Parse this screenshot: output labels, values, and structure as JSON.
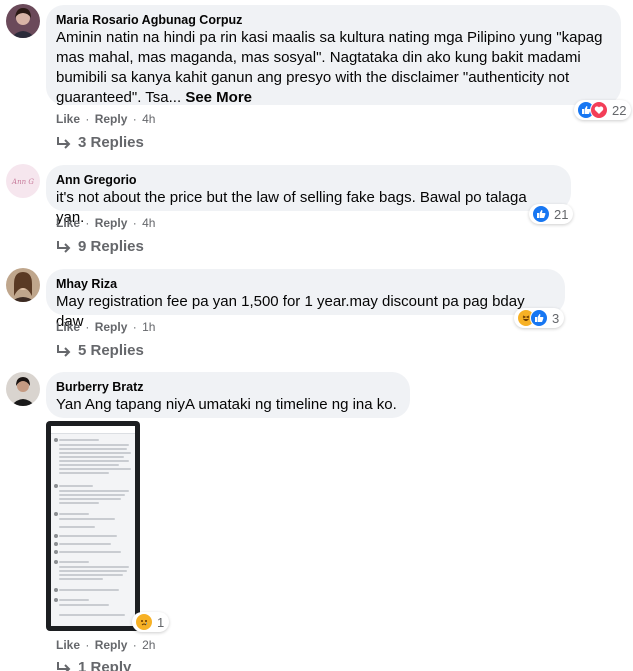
{
  "comments": [
    {
      "author": "Maria Rosario Agbunag Corpuz",
      "text": "Aminin natin na hindi pa rin kasi maalis sa kultura nating mga Pilipino yung \"kapag mas mahal, mas maganda, mas sosyal\". Nagtataka din ako kung bakit madami bumibili sa kanya kahit ganun ang presyo with the disclaimer \"authenticity not guaranteed\". Tsa...",
      "see_more": "See More",
      "like": "Like",
      "reply": "Reply",
      "time": "4h",
      "reaction_count": "22",
      "replies": "3 Replies",
      "reaction_icons": [
        "like-icon",
        "love-icon"
      ]
    },
    {
      "author": "Ann Gregorio",
      "text": "it's not about the price but the law of selling fake bags. Bawal po talaga yan.",
      "like": "Like",
      "reply": "Reply",
      "time": "4h",
      "reaction_count": "21",
      "replies": "9 Replies",
      "reaction_icons": [
        "like-icon"
      ]
    },
    {
      "author": "Mhay Riza",
      "text": "May registration fee pa yan 1,500 for 1 year.may discount pa pag bday daw",
      "like": "Like",
      "reply": "Reply",
      "time": "1h",
      "reaction_count": "3",
      "replies": "5 Replies",
      "reaction_icons": [
        "haha-icon",
        "like-icon"
      ]
    },
    {
      "author": "Burberry Bratz",
      "text": "Yan Ang tapang niyA umataki ng timeline ng ina ko.",
      "like": "Like",
      "reply": "Reply",
      "time": "2h",
      "reaction_count": "1",
      "replies": "1 Reply",
      "reaction_icons": [
        "sad-icon"
      ]
    }
  ],
  "colors": {
    "bubble": "#f0f2f5",
    "meta": "#65676b",
    "like_blue": "#1877f2",
    "love_red": "#f33e58",
    "emoji_yellow": "#f7b125"
  },
  "separator": "·"
}
